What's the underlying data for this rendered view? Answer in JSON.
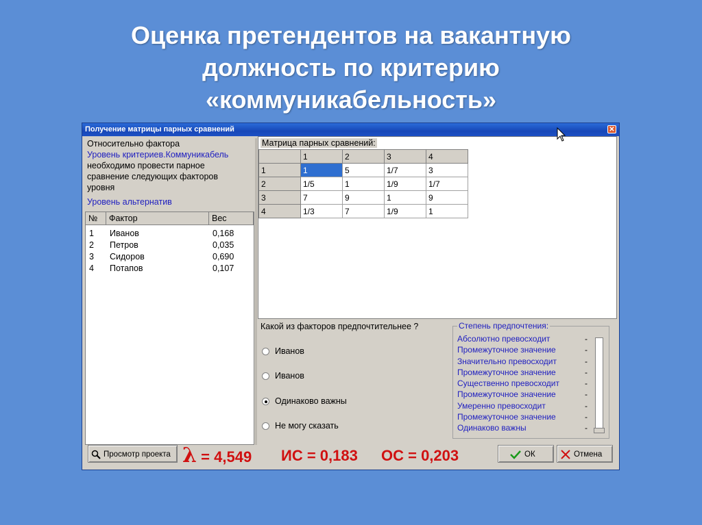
{
  "slide": {
    "title_lines": [
      "Оценка претендентов на вакантную",
      "должность по  критерию",
      "«коммуникабельность»"
    ]
  },
  "window": {
    "title": "Получение матрицы парных сравнений",
    "close_label": "✕"
  },
  "factor_info": {
    "line1": "Относительно фактора",
    "line2": "Уровень критериев.Коммуникабель",
    "line3": "необходимо провести парное",
    "line4": "сравнение следующих факторов",
    "line5": "уровня",
    "line6": "Уровень альтернатив"
  },
  "factor_table": {
    "headers": [
      "№",
      "Фактор",
      "Вес"
    ],
    "rows": [
      {
        "n": "1",
        "name": "Иванов",
        "w": "0,168"
      },
      {
        "n": "2",
        "name": "Петров",
        "w": "0,035"
      },
      {
        "n": "3",
        "name": "Сидоров",
        "w": "0,690"
      },
      {
        "n": "4",
        "name": "Потапов",
        "w": "0,107"
      }
    ]
  },
  "matrix": {
    "caption": "Матрица парных сравнений:",
    "col_headers": [
      "",
      "1",
      "2",
      "3",
      "4"
    ],
    "rows": [
      {
        "h": "1",
        "c": [
          "1",
          "5",
          "1/7",
          "3"
        ]
      },
      {
        "h": "2",
        "c": [
          "1/5",
          "1",
          "1/9",
          "1/7"
        ]
      },
      {
        "h": "3",
        "c": [
          "7",
          "9",
          "1",
          "9"
        ]
      },
      {
        "h": "4",
        "c": [
          "1/3",
          "7",
          "1/9",
          "1"
        ]
      }
    ]
  },
  "question": {
    "text": "Какой из факторов предпочтительнее ?",
    "options": [
      "Иванов",
      "Иванов",
      "Одинаково важны",
      "Не могу сказать"
    ]
  },
  "preference": {
    "title": "Степень предпочтения:",
    "items": [
      "Абсолютно превосходит",
      "Промежуточное значение",
      "Значительно превосходит",
      "Промежуточное значение",
      "Существенно превосходит",
      "Промежуточное значение",
      "Умеренно превосходит",
      "Промежуточное значение",
      "Одинаково важны"
    ],
    "dash": "-"
  },
  "bottom": {
    "view_project": "Просмотр проекта",
    "lambda_symbol": "λ",
    "lambda_value": "= 4,549",
    "ic": "ИС = 0,183",
    "oc": "ОС = 0,203",
    "ok": "ОК",
    "cancel": "Отмена"
  },
  "colors": {
    "background": "#5b8ed6",
    "metric_red": "#d01010",
    "link_blue": "#2020c0"
  }
}
